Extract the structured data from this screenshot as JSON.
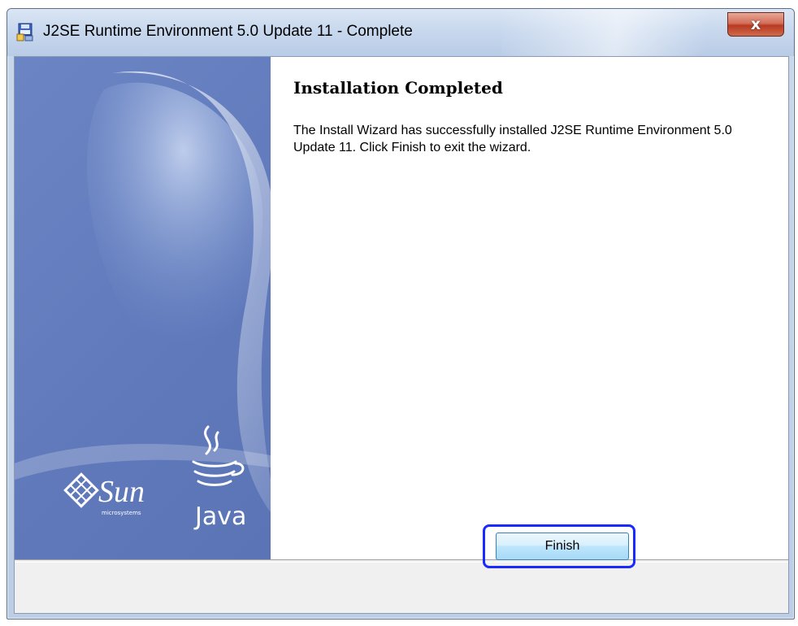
{
  "window": {
    "title": "J2SE Runtime Environment 5.0 Update 11 - Complete",
    "icon": "installer-icon",
    "close_symbol": "x"
  },
  "banner": {
    "brand_left": "Sun",
    "brand_left_sub": "microsystems",
    "brand_right": "Java",
    "colors": {
      "background": "#5f79bb",
      "swoosh": "#8fa7d8"
    }
  },
  "content": {
    "heading": "Installation Completed",
    "message": "The Install Wizard has successfully installed J2SE Runtime Environment 5.0 Update 11. Click Finish to exit the wizard."
  },
  "buttons": {
    "finish_label": "Finish"
  },
  "colors": {
    "highlight": "#1a29ff",
    "button_border": "#3c7fb1",
    "close_button": "#c4452c"
  }
}
